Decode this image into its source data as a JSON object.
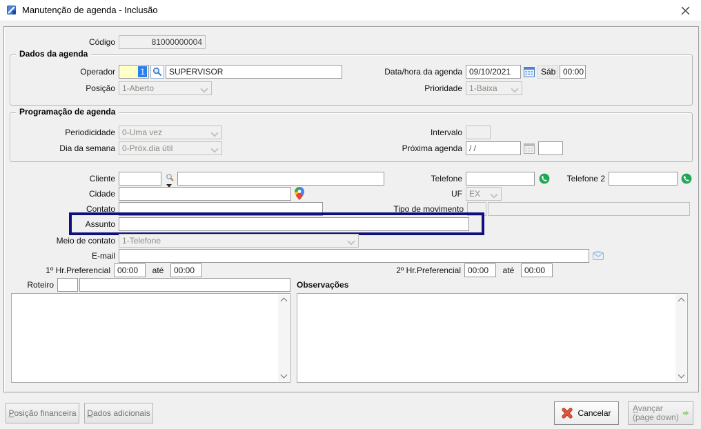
{
  "window": {
    "title": "Manutenção de agenda - Inclusão"
  },
  "header": {
    "codigo_label": "Código",
    "codigo_value": "81000000004"
  },
  "dados_agenda": {
    "legend": "Dados da agenda",
    "operador_label": "Operador",
    "operador_code": "1",
    "operador_name": "SUPERVISOR",
    "posicao_label": "Posição",
    "posicao_value": "1-Aberto",
    "data_label": "Data/hora da agenda",
    "data_value": "09/10/2021",
    "weekday": "Sáb",
    "time_value": "00:00",
    "prioridade_label": "Prioridade",
    "prioridade_value": "1-Baixa"
  },
  "programacao": {
    "legend": "Programação de agenda",
    "periodicidade_label": "Periodicidade",
    "periodicidade_value": "0-Uma vez",
    "dia_semana_label": "Dia da semana",
    "dia_semana_value": "0-Próx.dia útil",
    "intervalo_label": "Intervalo",
    "intervalo_value": "",
    "proxima_label": "Próxima agenda",
    "proxima_value": "/ /",
    "proxima_extra": ""
  },
  "contact": {
    "cliente_label": "Cliente",
    "cliente_code": "",
    "cliente_name": "",
    "cidade_label": "Cidade",
    "cidade_value": "",
    "contato_label": "Contato",
    "contato_value": "",
    "assunto_label": "Assunto",
    "assunto_value": "",
    "meio_label": "Meio de contato",
    "meio_value": "1-Telefone",
    "email_label": "E-mail",
    "email_value": "",
    "telefone_label": "Telefone",
    "telefone_value": "",
    "telefone2_label": "Telefone 2",
    "telefone2_value": "",
    "uf_label": "UF",
    "uf_value": "EX",
    "tipo_label": "Tipo de movimento",
    "tipo_code": "",
    "tipo_value": "",
    "hr1_label": "1º Hr.Preferencial",
    "hr1_from": "00:00",
    "hr1_ate": "até",
    "hr1_to": "00:00",
    "hr2_label": "2º Hr.Preferencial",
    "hr2_from": "00:00",
    "hr2_ate": "até",
    "hr2_to": "00:00",
    "roteiro_label": "Roteiro",
    "roteiro_code": "",
    "roteiro_value": "",
    "observacoes_label": "Observações",
    "roteiro_text": "",
    "observacoes_text": ""
  },
  "footer": {
    "posicao_financeira_accel": "P",
    "posicao_financeira_rest": "osição financeira",
    "dados_adicionais_accel": "D",
    "dados_adicionais_rest": "ados adicionais",
    "cancelar_label": "Cancelar",
    "avancar_accel": "A",
    "avancar_rest": "vançar",
    "avancar_line2": "(page down)"
  },
  "icons": {
    "titlebar": "agenda-app-icon",
    "operador_lookup": "magnifier-icon",
    "cliente_lookup": "magnifier-icon",
    "date_picker": "calendar-icon",
    "proxima_date_picker": "calendar-icon-disabled",
    "cidade_map": "google-maps-pin-icon",
    "telefone": "whatsapp-icon",
    "telefone2": "whatsapp-icon",
    "email": "envelope-icon",
    "cancelar": "red-x-icon",
    "avancar": "green-arrow-icon"
  },
  "colors": {
    "highlight_box": "#10107d",
    "selection_blue": "#2a7ff0",
    "field_yellow": "#ffffc8",
    "whatsapp_green": "#1fa855",
    "cancel_red": "#d6452f",
    "advance_green": "#93d377"
  }
}
